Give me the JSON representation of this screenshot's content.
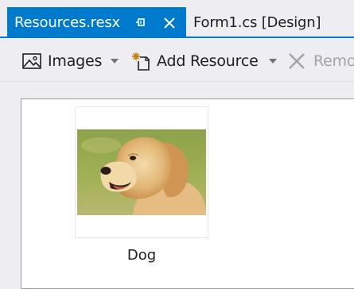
{
  "tabs": {
    "active_title": "Resources.resx",
    "inactive_title": "Form1.cs [Design]"
  },
  "toolbar": {
    "images_label": "Images",
    "add_resource_label": "Add Resource",
    "remove_label": "Remo"
  },
  "resources": [
    {
      "name": "Dog",
      "image": "golden-retriever-photo"
    }
  ],
  "colors": {
    "accent": "#007acc",
    "background": "#eeeef2",
    "disabled_text": "#a2a4a5"
  }
}
